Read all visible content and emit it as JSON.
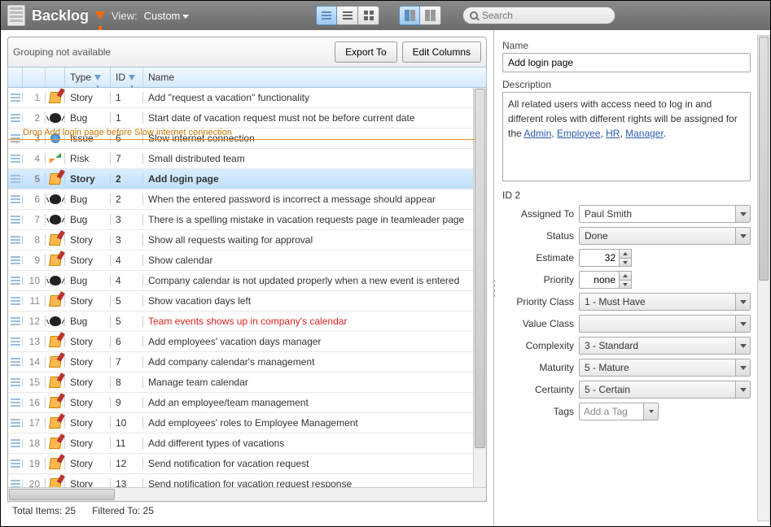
{
  "toolbar": {
    "title": "Backlog",
    "view_label": "View:",
    "view_value": "Custom",
    "search_placeholder": "Search"
  },
  "grid": {
    "grouping_note": "Grouping not available",
    "export_label": "Export To",
    "edit_cols_label": "Edit Columns",
    "headers": {
      "type": "Type",
      "id": "ID",
      "name": "Name"
    },
    "drop_hint": "Drop Add login page before Slow internet connection",
    "rows": [
      {
        "n": "1",
        "type": "Story",
        "id": "1",
        "name": "Add \"request a vacation\" functionality",
        "icon": "story"
      },
      {
        "n": "2",
        "type": "Bug",
        "id": "1",
        "name": "Start date of vacation request must not be before current date",
        "icon": "bug"
      },
      {
        "n": "3",
        "type": "Issue",
        "id": "6",
        "name": "Slow internet connection",
        "icon": "issue"
      },
      {
        "n": "4",
        "type": "Risk",
        "id": "7",
        "name": "Small distributed team",
        "icon": "risk"
      },
      {
        "n": "5",
        "type": "Story",
        "id": "2",
        "name": "Add login page",
        "icon": "story",
        "selected": true
      },
      {
        "n": "6",
        "type": "Bug",
        "id": "2",
        "name": "When the entered password is incorrect a message should appear",
        "icon": "bug"
      },
      {
        "n": "7",
        "type": "Bug",
        "id": "3",
        "name": "There is a spelling mistake in vacation requests page in teamleader page",
        "icon": "bug"
      },
      {
        "n": "8",
        "type": "Story",
        "id": "3",
        "name": "Show all requests waiting for approval",
        "icon": "story"
      },
      {
        "n": "9",
        "type": "Story",
        "id": "4",
        "name": "Show calendar",
        "icon": "story"
      },
      {
        "n": "10",
        "type": "Bug",
        "id": "4",
        "name": "Company calendar is not updated properly when a new event is entered",
        "icon": "bug"
      },
      {
        "n": "11",
        "type": "Story",
        "id": "5",
        "name": "Show vacation days left",
        "icon": "story"
      },
      {
        "n": "12",
        "type": "Bug",
        "id": "5",
        "name": "Team events shows up in company's calendar",
        "icon": "bug",
        "red": true
      },
      {
        "n": "13",
        "type": "Story",
        "id": "6",
        "name": "Add employees' vacation days manager",
        "icon": "story"
      },
      {
        "n": "14",
        "type": "Story",
        "id": "7",
        "name": "Add company calendar's management",
        "icon": "story"
      },
      {
        "n": "15",
        "type": "Story",
        "id": "8",
        "name": "Manage team calendar",
        "icon": "story"
      },
      {
        "n": "16",
        "type": "Story",
        "id": "9",
        "name": "Add an employee/team management",
        "icon": "story"
      },
      {
        "n": "17",
        "type": "Story",
        "id": "10",
        "name": "Add employees' roles to Employee Management",
        "icon": "story"
      },
      {
        "n": "18",
        "type": "Story",
        "id": "11",
        "name": "Add different types of vacations",
        "icon": "story"
      },
      {
        "n": "19",
        "type": "Story",
        "id": "12",
        "name": "Send notification for vacation request",
        "icon": "story"
      },
      {
        "n": "20",
        "type": "Story",
        "id": "13",
        "name": "Send notification for vacation request response",
        "icon": "story"
      }
    ],
    "status": {
      "total_label": "Total Items:",
      "total": "25",
      "filtered_label": "Filtered To:",
      "filtered": "25"
    }
  },
  "details": {
    "name_label": "Name",
    "name_value": "Add login page",
    "desc_label": "Description",
    "desc_text": "All related users with access need to log in and different roles with different rights will be assigned for the ",
    "desc_links": [
      "Admin",
      "Employee",
      "HR",
      "Manager"
    ],
    "id_label": "ID",
    "id_value": "2",
    "fields": {
      "assigned_label": "Assigned To",
      "assigned_value": "Paul Smith",
      "status_label": "Status",
      "status_value": "Done",
      "estimate_label": "Estimate",
      "estimate_value": "32",
      "priority_label": "Priority",
      "priority_value": "none",
      "pclass_label": "Priority Class",
      "pclass_value": "1 - Must Have",
      "vclass_label": "Value Class",
      "vclass_value": "",
      "complexity_label": "Complexity",
      "complexity_value": "3 - Standard",
      "maturity_label": "Maturity",
      "maturity_value": "5 - Mature",
      "certainty_label": "Certainty",
      "certainty_value": "5 - Certain",
      "tags_label": "Tags",
      "tags_placeholder": "Add a Tag"
    }
  }
}
